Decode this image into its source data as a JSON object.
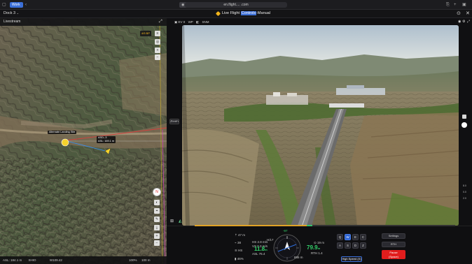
{
  "browser": {
    "workspace": "Work",
    "tab_title": "",
    "url": "en.flight.... .com",
    "back_icon": "chevron-left-icon"
  },
  "app": {
    "dock_title": "Dock 3",
    "mode_title_pre": "Live Flight ",
    "mode_title_hl": "Controls",
    "mode_title_post": "-Manual"
  },
  "map": {
    "header": "Livestream",
    "marker_label": "Alternate Landing Site",
    "drone_label_1": "ASD--3",
    "drone_label_2": "ASL: 169.1 m",
    "top_badge": "4/5 BP",
    "footer_left": "ASL: 184.1 m",
    "footer_mid": "SHIO",
    "footer_scale": "100 m",
    "footer_coords": "W109.42",
    "footer_pct": "100%"
  },
  "camera": {
    "header_mode": "EV 0",
    "header_res": "WP",
    "header_extra": "SNM",
    "zoom_label": "Zoom"
  },
  "telemetry": {
    "altitude_top": "47 m",
    "wind_label": "HS",
    "hs_value": "2.8 m/s",
    "vs_value": "0.3 m/s",
    "alt_val": "11.8",
    "alt_unit": "m",
    "asl": "76.4",
    "heading_top": "-97",
    "heading_sub": "H/17",
    "dist_label": "19 m",
    "dist_value": "79.9",
    "dist_unit": "m",
    "rth": "RTH 1.4",
    "speed_small": "886 m",
    "battery": "46%",
    "signal": "38"
  },
  "controls": {
    "keys_top": [
      "Q",
      "W",
      "E",
      "C"
    ],
    "keys_bottom": [
      "A",
      "S",
      "D",
      "Z"
    ],
    "settings_label": "Settings",
    "rth_label": "RTH",
    "pause_label_1": "Pause",
    "pause_label_2": "(Space)",
    "speed_label": "High Speed (X)"
  },
  "colors": {
    "accent": "#2e63d1",
    "danger": "#e11d1d",
    "ok": "#33d26a",
    "warn": "#f3b51c"
  },
  "right_scale": [
    "8.0",
    "0.0",
    "2.0"
  ]
}
